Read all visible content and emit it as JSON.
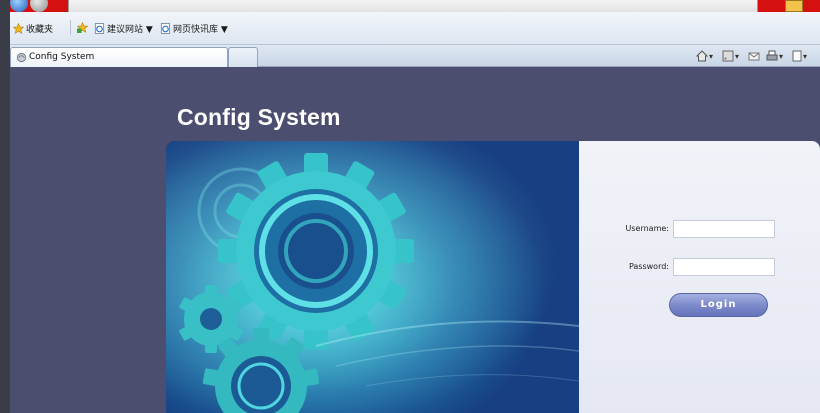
{
  "browser": {
    "favorites_bar": {
      "favorites_label": "收藏夹",
      "suggested_sites_label": "建议网站 ▼",
      "web_slice_gallery_label": "网页快讯库 ▼"
    },
    "tab": {
      "title": "Config System"
    },
    "command_bar": {
      "dropdown_glyph": "▾"
    }
  },
  "page": {
    "title": "Config System",
    "login": {
      "username_label": "Username:",
      "username_value": "",
      "password_label": "Password:",
      "password_value": "",
      "login_button_label": "Login"
    }
  },
  "colors": {
    "title_bar": "#d51010",
    "page_background": "#4b4e6e",
    "login_button": "#7d8bcb",
    "banner_accent": "#4fd6e0"
  },
  "icons": {
    "favorites": "star-icon",
    "add_favorites": "add-favorites-icon",
    "suggested_sites": "ie-page-icon",
    "web_slice": "ie-page-icon",
    "tab": "page-icon",
    "home": "home-icon",
    "feeds": "rss-icon",
    "mail": "mail-icon",
    "print": "print-icon"
  }
}
